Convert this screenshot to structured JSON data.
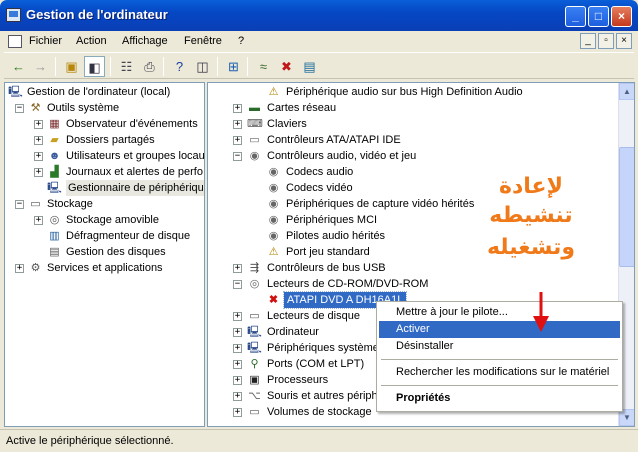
{
  "window": {
    "title": "Gestion de l'ordinateur",
    "controls": {
      "minimize": "_",
      "maximize": "□",
      "close": "×"
    }
  },
  "menu": {
    "items": [
      "Fichier",
      "Action",
      "Affichage",
      "Fenêtre",
      "?"
    ],
    "mdi_controls": [
      "_",
      "▫",
      "×"
    ]
  },
  "toolbar": {
    "icons": [
      "back-icon",
      "forward-icon",
      "up-folder-icon",
      "show-tree-icon",
      "properties-icon",
      "print-icon",
      "help-icon",
      "console-icon",
      "scan-hardware-icon",
      "uninstall-icon",
      "disable-icon",
      "enable-icon"
    ]
  },
  "tree": {
    "items": [
      {
        "label": "Gestion de l'ordinateur (local)",
        "icon": "computer-icon",
        "expander": ""
      },
      {
        "label": "Outils système",
        "icon": "tools-icon",
        "expander": "−"
      },
      {
        "label": "Observateur d'événements",
        "icon": "event-viewer-icon",
        "expander": "+"
      },
      {
        "label": "Dossiers partagés",
        "icon": "shared-folder-icon",
        "expander": "+"
      },
      {
        "label": "Utilisateurs et groupes locau",
        "icon": "users-icon",
        "expander": "+"
      },
      {
        "label": "Journaux et alertes de perfo",
        "icon": "performance-icon",
        "expander": "+"
      },
      {
        "label": "Gestionnaire de périphérique",
        "icon": "device-manager-icon",
        "expander": ""
      },
      {
        "label": "Stockage",
        "icon": "storage-icon",
        "expander": "−"
      },
      {
        "label": "Stockage amovible",
        "icon": "removable-storage-icon",
        "expander": "+"
      },
      {
        "label": "Défragmenteur de disque",
        "icon": "defrag-icon",
        "expander": ""
      },
      {
        "label": "Gestion des disques",
        "icon": "disk-management-icon",
        "expander": ""
      },
      {
        "label": "Services et applications",
        "icon": "services-icon",
        "expander": "+"
      }
    ]
  },
  "devices": {
    "items": [
      {
        "label": "Périphérique audio sur bus High Definition Audio",
        "icon": "warning-device-icon",
        "expander": ""
      },
      {
        "label": "Cartes réseau",
        "icon": "network-card-icon",
        "expander": "+"
      },
      {
        "label": "Claviers",
        "icon": "keyboard-icon",
        "expander": "+"
      },
      {
        "label": "Contrôleurs ATA/ATAPI IDE",
        "icon": "ide-controller-icon",
        "expander": "+"
      },
      {
        "label": "Contrôleurs audio, vidéo et jeu",
        "icon": "sound-icon",
        "expander": "−"
      },
      {
        "label": "Codecs audio",
        "icon": "codec-icon",
        "expander": ""
      },
      {
        "label": "Codecs vidéo",
        "icon": "codec-icon",
        "expander": ""
      },
      {
        "label": "Périphériques de capture vidéo hérités",
        "icon": "codec-icon",
        "expander": ""
      },
      {
        "label": "Périphériques MCI",
        "icon": "codec-icon",
        "expander": ""
      },
      {
        "label": "Pilotes audio hérités",
        "icon": "codec-icon",
        "expander": ""
      },
      {
        "label": "Port jeu standard",
        "icon": "warning-device-icon",
        "expander": ""
      },
      {
        "label": "Contrôleurs de bus USB",
        "icon": "usb-icon",
        "expander": "+"
      },
      {
        "label": "Lecteurs de CD-ROM/DVD-ROM",
        "icon": "cdrom-icon",
        "expander": "−"
      },
      {
        "label": "ATAPI DVD A  DH16A1L",
        "icon": "disabled-cdrom-icon",
        "expander": ""
      },
      {
        "label": "Lecteurs de disque",
        "icon": "disk-drive-icon",
        "expander": "+"
      },
      {
        "label": "Ordinateur",
        "icon": "computer-icon",
        "expander": "+"
      },
      {
        "label": "Périphériques système",
        "icon": "system-device-icon",
        "expander": "+"
      },
      {
        "label": "Ports (COM et LPT)",
        "icon": "port-icon",
        "expander": "+"
      },
      {
        "label": "Processeurs",
        "icon": "processor-icon",
        "expander": "+"
      },
      {
        "label": "Souris et autres périph",
        "icon": "mouse-icon",
        "expander": "+"
      },
      {
        "label": "Volumes de stockage",
        "icon": "volume-icon",
        "expander": "+"
      }
    ]
  },
  "context_menu": {
    "update_driver": "Mettre à jour le pilote...",
    "enable": "Activer",
    "uninstall": "Désinstaller",
    "scan": "Rechercher les modifications sur le matériel",
    "properties": "Propriétés"
  },
  "annotation": {
    "lines": [
      "لإعادة",
      "تنشيطه",
      "وتشغيله"
    ],
    "color": "#f07a1a"
  },
  "status": {
    "text": "Active le périphérique sélectionné."
  }
}
